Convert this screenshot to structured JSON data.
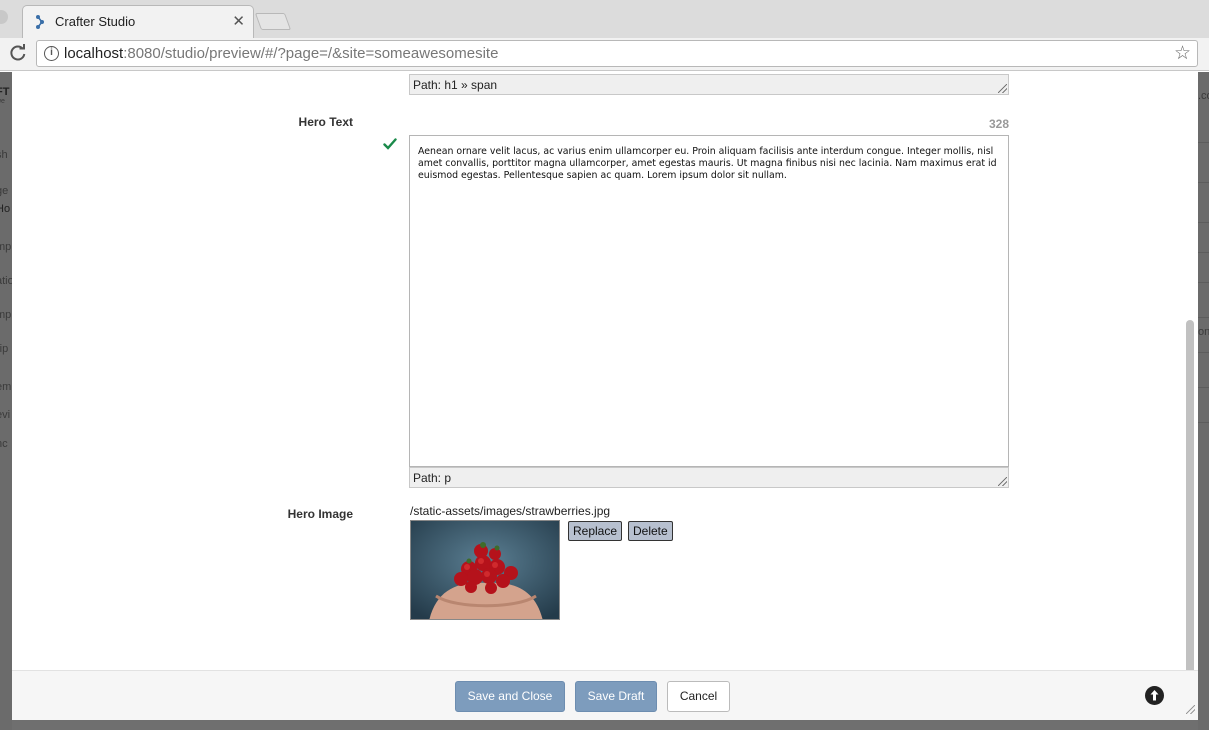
{
  "browser": {
    "tab_title": "Crafter Studio",
    "tab_close": "✕",
    "url_host": "localhost",
    "url_rest": ":8080/studio/preview/#/?page=/&site=someawesomesite"
  },
  "background": {
    "left_fragments": [
      "FT",
      "we",
      "sh",
      "ge",
      "Ho",
      "mp",
      "atio",
      "mp",
      "rip",
      "em",
      "evi",
      "nc"
    ],
    "right_fragments": [
      ".co",
      "on"
    ]
  },
  "form": {
    "top_path": "Path: h1 » span",
    "hero_text": {
      "label": "Hero Text",
      "char_count": "328",
      "content": "Aenean ornare velit lacus, ac varius enim ullamcorper eu. Proin aliquam facilisis ante interdum congue. Integer mollis, nisl amet convallis, porttitor magna ullamcorper, amet egestas mauris. Ut magna finibus nisi nec lacinia. Nam maximus erat id euismod egestas. Pellentesque sapien ac quam. Lorem ipsum dolor sit nullam.",
      "path": "Path: p"
    },
    "hero_image": {
      "label": "Hero Image",
      "path": "/static-assets/images/strawberries.jpg",
      "replace_label": "Replace",
      "delete_label": "Delete"
    }
  },
  "footer": {
    "save_close_label": "Save and Close",
    "save_draft_label": "Save Draft",
    "cancel_label": "Cancel"
  },
  "colors": {
    "primary_button": "#7d9cbd",
    "valid_check": "#1a8a4a"
  }
}
